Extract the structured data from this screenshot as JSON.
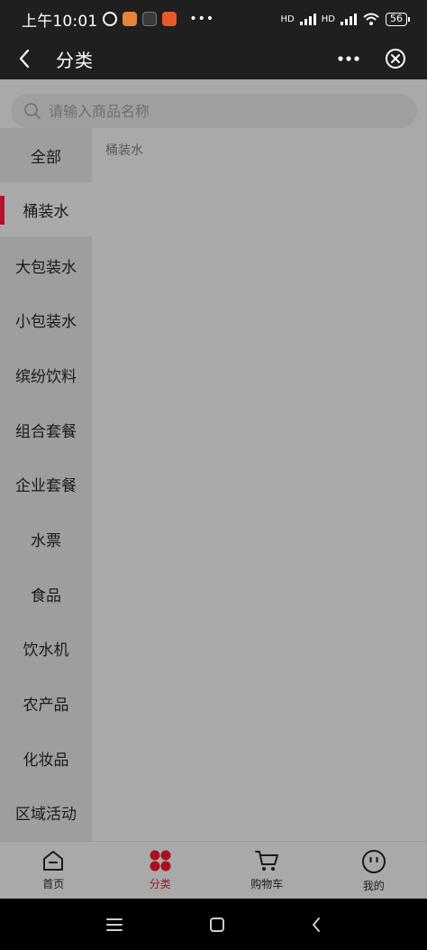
{
  "status_bar": {
    "time": "上午10:01",
    "battery": "56",
    "signal_labels": [
      "HD",
      "HD"
    ]
  },
  "nav": {
    "title": "分类"
  },
  "search": {
    "placeholder": "请输入商品名称"
  },
  "sidebar": {
    "items": [
      {
        "label": "全部",
        "active": false
      },
      {
        "label": "桶装水",
        "active": true
      },
      {
        "label": "大包装水",
        "active": false
      },
      {
        "label": "小包装水",
        "active": false
      },
      {
        "label": "缤纷饮料",
        "active": false
      },
      {
        "label": "组合套餐",
        "active": false
      },
      {
        "label": "企业套餐",
        "active": false
      },
      {
        "label": "水票",
        "active": false
      },
      {
        "label": "食品",
        "active": false
      },
      {
        "label": "饮水机",
        "active": false
      },
      {
        "label": "农产品",
        "active": false
      },
      {
        "label": "化妆品",
        "active": false
      },
      {
        "label": "区域活动",
        "active": false
      }
    ]
  },
  "content": {
    "category_title": "桶装水"
  },
  "tab_bar": {
    "tabs": [
      {
        "label": "首页",
        "icon": "home-icon"
      },
      {
        "label": "分类",
        "icon": "category-icon",
        "active": true
      },
      {
        "label": "购物车",
        "icon": "cart-icon"
      },
      {
        "label": "我的",
        "icon": "profile-icon"
      }
    ]
  },
  "colors": {
    "accent": "#b3122a",
    "header_bg": "#1f1f1f",
    "page_bg": "#a9a9a9"
  }
}
